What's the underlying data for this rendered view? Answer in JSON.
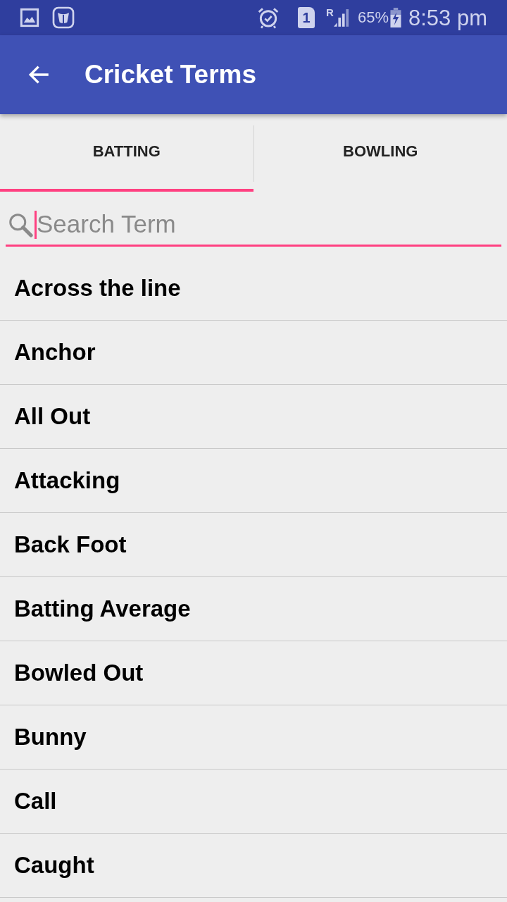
{
  "status_bar": {
    "sim_slot": "1",
    "roaming": "R",
    "battery": "65%",
    "time": "8:53 pm"
  },
  "app_bar": {
    "title": "Cricket Terms"
  },
  "tabs": [
    {
      "label": "BATTING",
      "selected": true
    },
    {
      "label": "BOWLING",
      "selected": false
    }
  ],
  "search": {
    "placeholder": "Search Term",
    "focused": true
  },
  "terms": [
    {
      "label": "Across the line"
    },
    {
      "label": "Anchor"
    },
    {
      "label": "All Out"
    },
    {
      "label": "Attacking"
    },
    {
      "label": "Back Foot"
    },
    {
      "label": "Batting Average"
    },
    {
      "label": "Bowled Out"
    },
    {
      "label": "Bunny"
    },
    {
      "label": "Call"
    },
    {
      "label": "Caught"
    }
  ]
}
